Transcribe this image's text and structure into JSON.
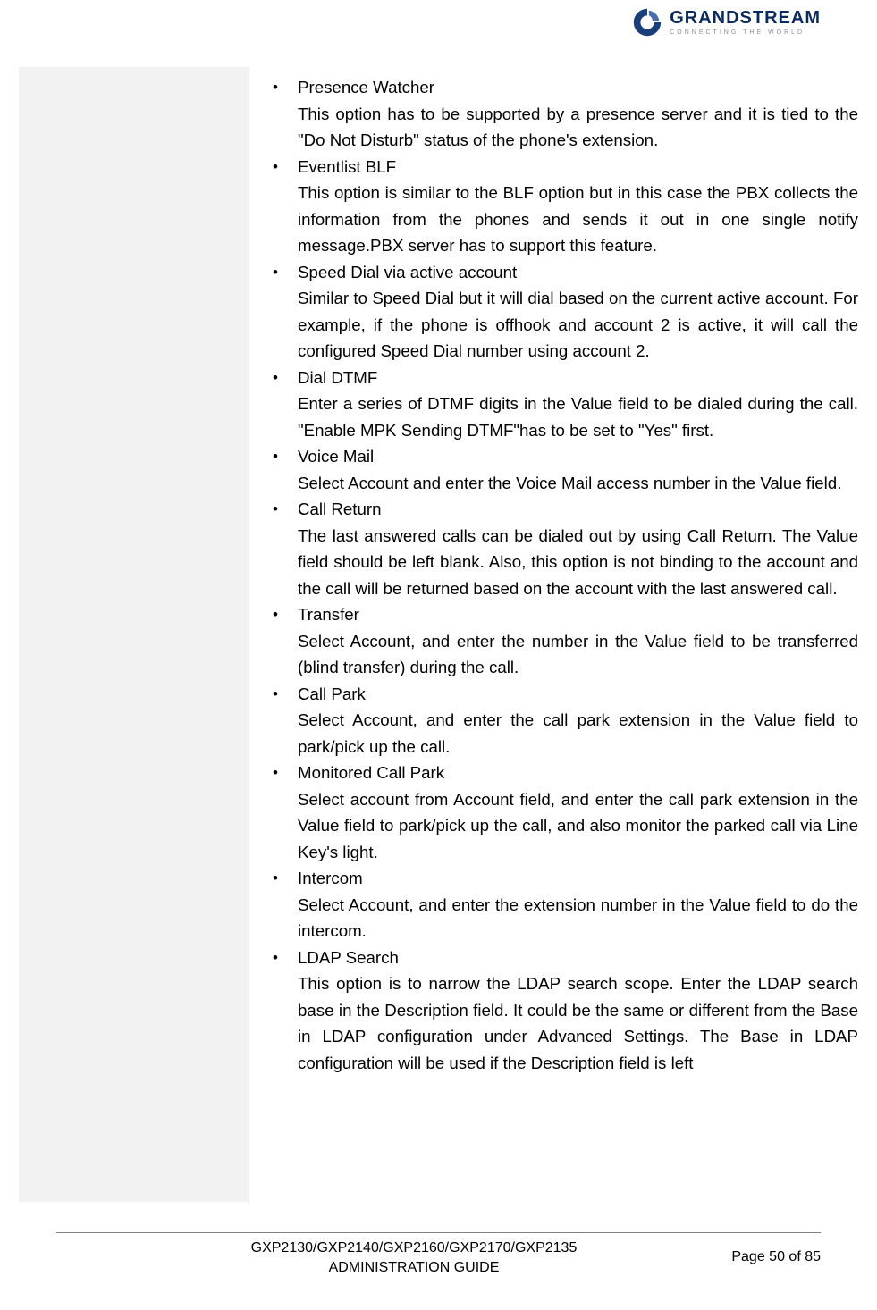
{
  "logo": {
    "name": "GRANDSTREAM",
    "tagline": "CONNECTING THE WORLD"
  },
  "items": [
    {
      "title": "Presence Watcher",
      "desc": "This option has to be supported by a presence server and it is tied to the \"Do Not Disturb\" status of the phone's extension."
    },
    {
      "title": "Eventlist BLF",
      "desc": "This option is similar to the BLF option but in this case the PBX collects the information from the phones and sends it out in one single notify message.PBX server has to support this feature."
    },
    {
      "title": "Speed Dial via active account",
      "desc": "Similar to Speed Dial but it will dial based on the current active account. For example, if the phone is offhook and account 2 is active, it will call the configured Speed Dial number using account 2."
    },
    {
      "title": "Dial DTMF",
      "desc": "Enter a series of DTMF digits in the Value field to be dialed during the call. \"Enable MPK Sending DTMF\"has to be set to \"Yes\" first."
    },
    {
      "title": "Voice Mail",
      "desc": "Select Account and enter the Voice Mail access number in the Value field."
    },
    {
      "title": "Call Return",
      "desc": "The last answered calls can be dialed out by using Call Return. The Value field should be left blank. Also, this option is not binding to the account and the call will be returned based on the account with the last answered call."
    },
    {
      "title": "Transfer",
      "desc": "Select Account, and enter the number in the Value field to be transferred (blind transfer) during the call."
    },
    {
      "title": "Call Park",
      "desc": "Select Account, and enter the call park extension in the Value field to park/pick up the call."
    },
    {
      "title": "Monitored Call Park",
      "desc": "Select account from Account field, and enter the call park extension in the Value field to park/pick up the call, and also monitor the parked call via Line Key's light."
    },
    {
      "title": "Intercom",
      "desc": "Select Account, and enter the extension number in the Value field to do the intercom."
    },
    {
      "title": "LDAP Search",
      "desc": "This option is to narrow the LDAP search scope. Enter the LDAP search base in the Description field. It could be the same or different from the Base in LDAP configuration under Advanced Settings. The Base in LDAP configuration will be used if the Description field is left"
    }
  ],
  "footer": {
    "title_line1": "GXP2130/GXP2140/GXP2160/GXP2170/GXP2135",
    "title_line2": "ADMINISTRATION GUIDE",
    "page": "Page 50 of 85"
  }
}
